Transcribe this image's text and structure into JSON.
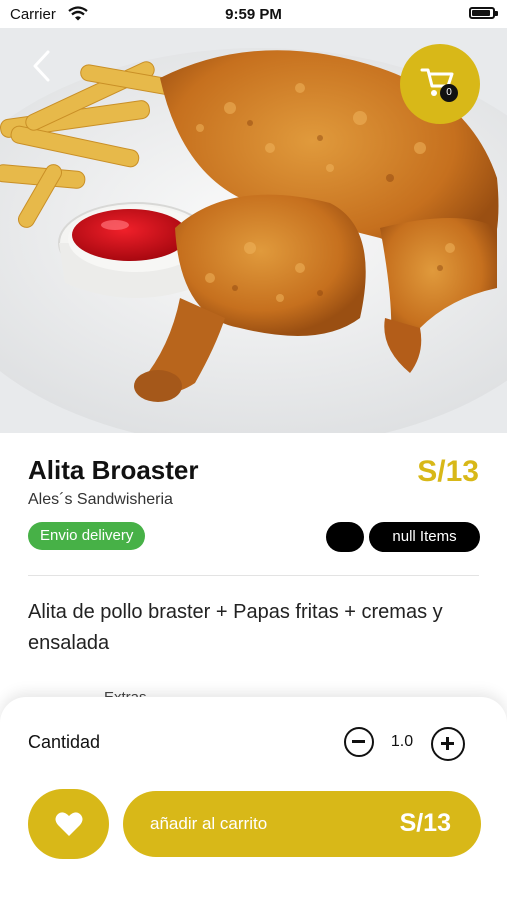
{
  "status_bar": {
    "carrier": "Carrier",
    "time": "9:59 PM"
  },
  "header": {
    "cart_count": "0"
  },
  "product": {
    "title": "Alita Broaster",
    "price": "S/13",
    "store": "Ales´s Sandwisheria",
    "delivery_label": "Envio delivery",
    "items_label": "null Items",
    "description": "Alita de pollo braster + Papas fritas + cremas y ensalada",
    "extras_label": "Extras"
  },
  "quantity": {
    "label": "Cantidad",
    "value": "1.0"
  },
  "actions": {
    "add_to_cart_label": "añadir al carrito",
    "add_to_cart_price": "S/13"
  },
  "colors": {
    "accent": "#d8b818",
    "delivery_green": "#47b147",
    "badge_black": "#000000"
  },
  "icons": [
    "back-chevron-icon",
    "cart-icon",
    "minus-circle-icon",
    "plus-circle-icon",
    "heart-icon",
    "wifi-icon",
    "battery-icon"
  ]
}
